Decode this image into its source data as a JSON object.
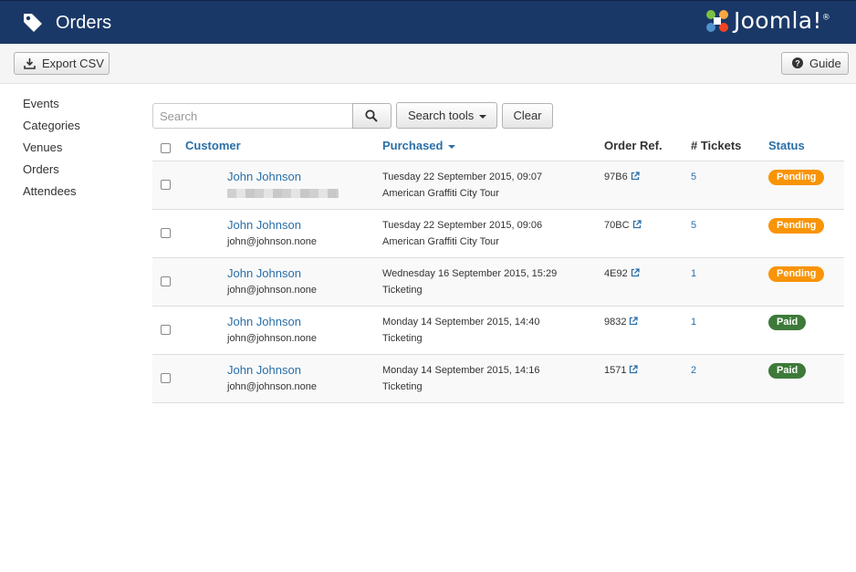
{
  "header": {
    "title": "Orders",
    "title_icon": "tag-icon",
    "logo_text": "Joomla!",
    "logo_mark": "®",
    "background": "#1a3867"
  },
  "toolbar": {
    "export_label": "Export CSV",
    "export_icon": "download-icon",
    "guide_label": "Guide",
    "guide_icon": "question-circle-icon"
  },
  "sidebar": {
    "items": [
      {
        "label": "Events"
      },
      {
        "label": "Categories"
      },
      {
        "label": "Venues"
      },
      {
        "label": "Orders"
      },
      {
        "label": "Attendees"
      }
    ]
  },
  "filters": {
    "search_placeholder": "Search",
    "search_tools_label": "Search tools",
    "clear_label": "Clear"
  },
  "table": {
    "columns": {
      "customer": "Customer",
      "purchased": "Purchased",
      "order_ref": "Order Ref.",
      "tickets": "# Tickets",
      "status": "Status"
    },
    "rows": [
      {
        "name": "John Johnson",
        "email": "",
        "email_redacted": true,
        "date": "Tuesday 22 September 2015, 09:07",
        "event": "American Graffiti City Tour",
        "ref": "97B6",
        "tickets": "5",
        "status": "Pending"
      },
      {
        "name": "John Johnson",
        "email": "john@johnson.none",
        "email_redacted": false,
        "date": "Tuesday 22 September 2015, 09:06",
        "event": "American Graffiti City Tour",
        "ref": "70BC",
        "tickets": "5",
        "status": "Pending"
      },
      {
        "name": "John Johnson",
        "email": "john@johnson.none",
        "email_redacted": false,
        "date": "Wednesday 16 September 2015, 15:29",
        "event": "Ticketing",
        "ref": "4E92",
        "tickets": "1",
        "status": "Pending"
      },
      {
        "name": "John Johnson",
        "email": "john@johnson.none",
        "email_redacted": false,
        "date": "Monday 14 September 2015, 14:40",
        "event": "Ticketing",
        "ref": "9832",
        "tickets": "1",
        "status": "Paid"
      },
      {
        "name": "John Johnson",
        "email": "john@johnson.none",
        "email_redacted": false,
        "date": "Monday 14 September 2015, 14:16",
        "event": "Ticketing",
        "ref": "1571",
        "tickets": "2",
        "status": "Paid"
      }
    ]
  },
  "colors": {
    "link": "#2a6fa8",
    "pending": "#f89406",
    "paid": "#3d7a3a"
  }
}
